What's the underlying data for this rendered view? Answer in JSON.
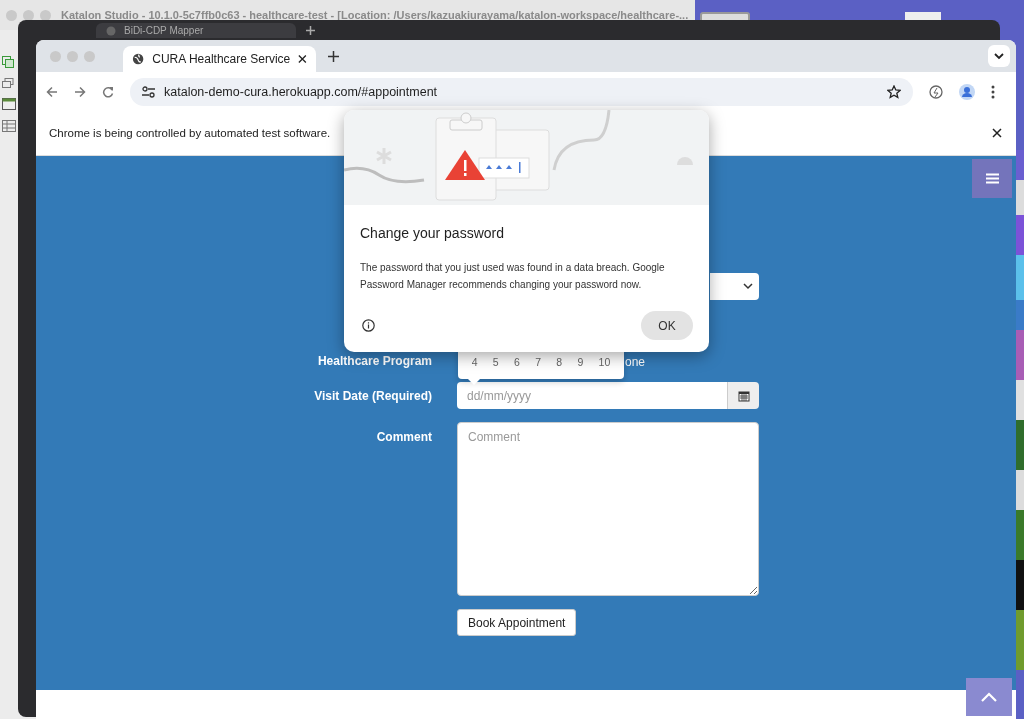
{
  "katalon_window": {
    "title": "Katalon Studio - 10.1.0-5c7ffb0c63 - healthcare-test - [Location: /Users/kazuakiurayama/katalon-workspace/healthcare-..."
  },
  "back_browser": {
    "tabs": [
      {
        "label": "BiDi-CDP Mapper",
        "selected": true
      }
    ]
  },
  "browser": {
    "tabs": [
      {
        "label": "CURA Healthcare Service",
        "selected": true
      }
    ],
    "url": "katalon-demo-cura.herokuapp.com/#appointment",
    "infobar": "Chrome is being controlled by automated test software."
  },
  "form": {
    "fields": [
      {
        "kind": "select"
      },
      {
        "kind": "radio",
        "label": "Healthcare Program",
        "option": "one"
      },
      {
        "kind": "date",
        "label": "Visit Date (Required)",
        "placeholder": "dd/mm/yyyy"
      },
      {
        "kind": "textarea",
        "label": "Comment",
        "placeholder": "Comment"
      },
      {
        "kind": "button",
        "label": "Book Appointment"
      }
    ]
  },
  "datepicker": {
    "days": [
      "4",
      "5",
      "6",
      "7",
      "8",
      "9",
      "10"
    ]
  },
  "dialog": {
    "title": "Change your password",
    "message": "The password that you just used was found in a data breach. Google Password Manager recommends changing your password now.",
    "button": "OK"
  }
}
